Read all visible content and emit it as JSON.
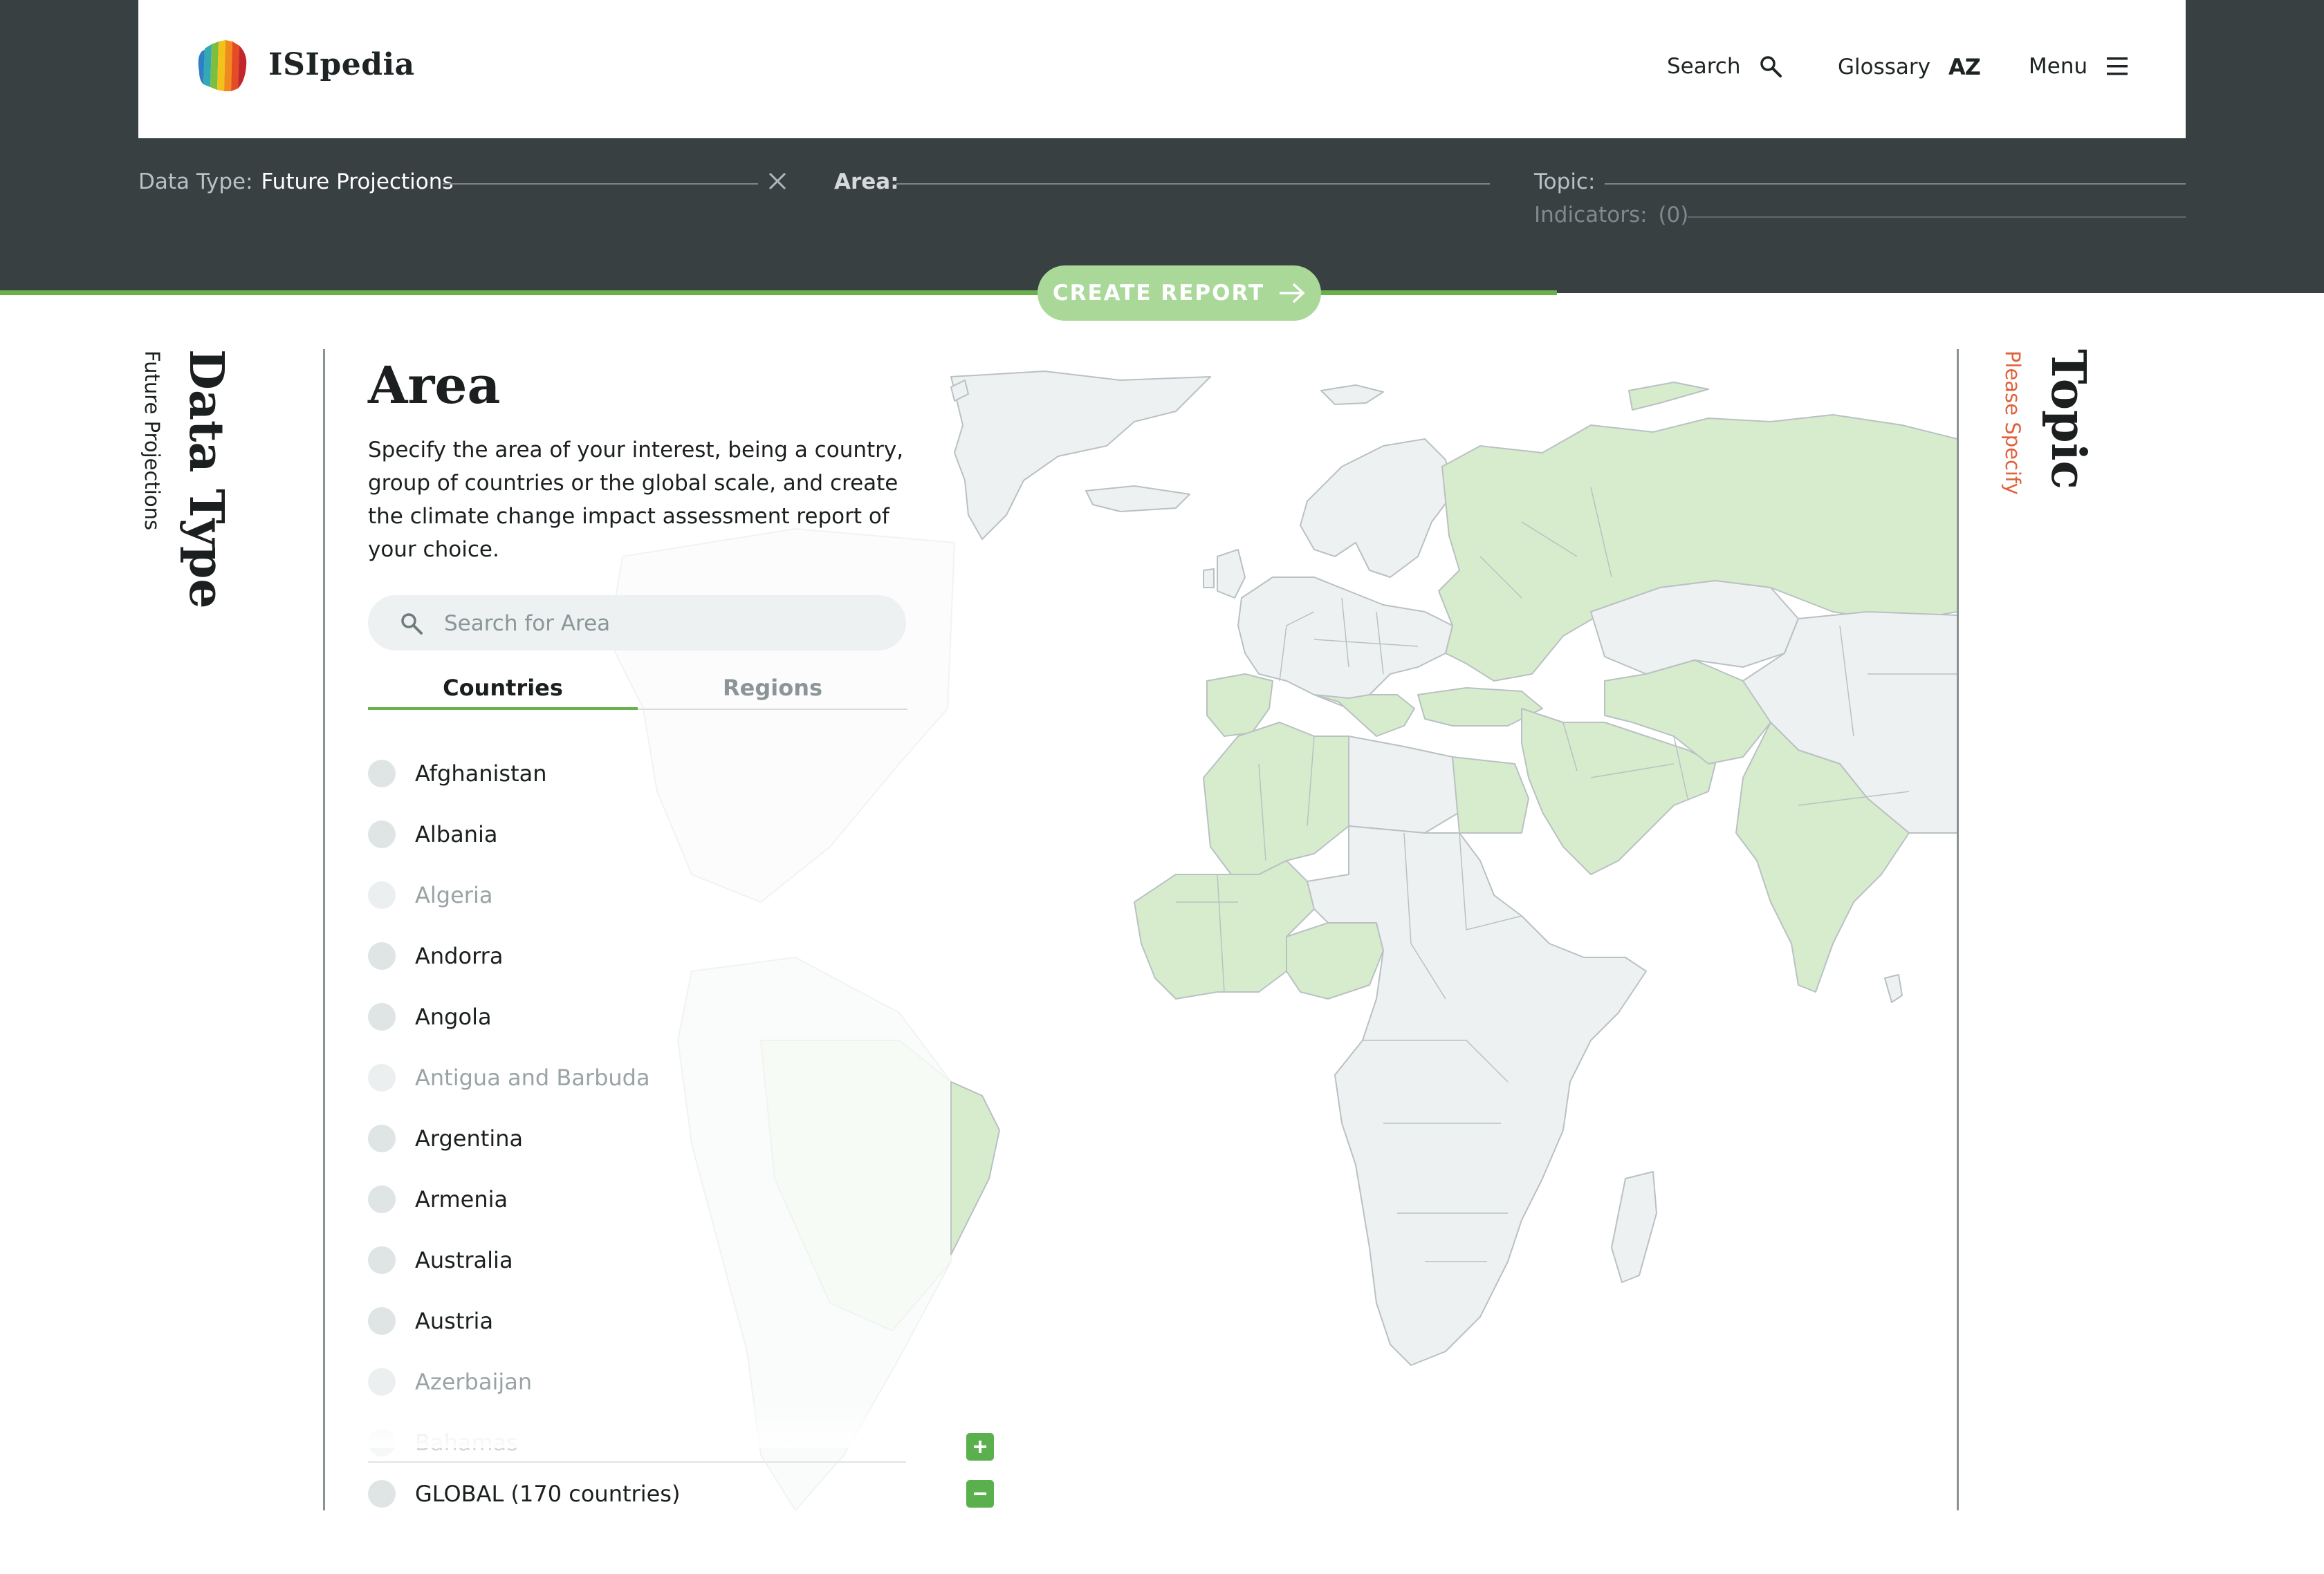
{
  "header": {
    "brand": "ISIpedia",
    "nav": {
      "search": "Search",
      "glossary": "Glossary",
      "glossary_icon": "AZ",
      "menu": "Menu"
    }
  },
  "filters": {
    "data_type_label": "Data Type:",
    "data_type_value": "Future Projections",
    "area_label": "Area:",
    "topic_label": "Topic:",
    "indicators_label": "Indicators:",
    "indicators_count": "(0)"
  },
  "create_report": "CREATE REPORT",
  "progress_fraction": 0.67,
  "left_column": {
    "title": "Data Type",
    "subtitle": "Future Projections"
  },
  "right_column": {
    "title": "Topic",
    "subtitle": "Please Specify"
  },
  "area_panel": {
    "title": "Area",
    "description": "Specify the area of your interest, being a country, group of countries or the global scale, and create the climate change impact assessment report of your choice.",
    "search_placeholder": "Search for Area",
    "tabs": {
      "countries": "Countries",
      "regions": "Regions"
    },
    "countries": [
      {
        "name": "Afghanistan",
        "available": true
      },
      {
        "name": "Albania",
        "available": true
      },
      {
        "name": "Algeria",
        "available": false
      },
      {
        "name": "Andorra",
        "available": true
      },
      {
        "name": "Angola",
        "available": true
      },
      {
        "name": "Antigua and Barbuda",
        "available": false
      },
      {
        "name": "Argentina",
        "available": true
      },
      {
        "name": "Armenia",
        "available": true
      },
      {
        "name": "Australia",
        "available": true
      },
      {
        "name": "Austria",
        "available": true
      },
      {
        "name": "Azerbaijan",
        "available": false
      },
      {
        "name": "Bahamas",
        "available": false
      }
    ],
    "global_option": "GLOBAL (170 countries)"
  },
  "colors": {
    "band": "#384042",
    "accent": "#6ab04c",
    "button": "#a9d899",
    "map_land": "#eef1f2",
    "map_highlight": "#d6eccd",
    "topic_warning": "#e0613e"
  },
  "icons": {
    "logo": "isipedia-logo",
    "search": "search-icon",
    "menu": "hamburger-icon",
    "clear": "close-icon",
    "arrow": "arrow-right-icon",
    "zoom_in": "plus-icon",
    "zoom_out": "minus-icon"
  }
}
